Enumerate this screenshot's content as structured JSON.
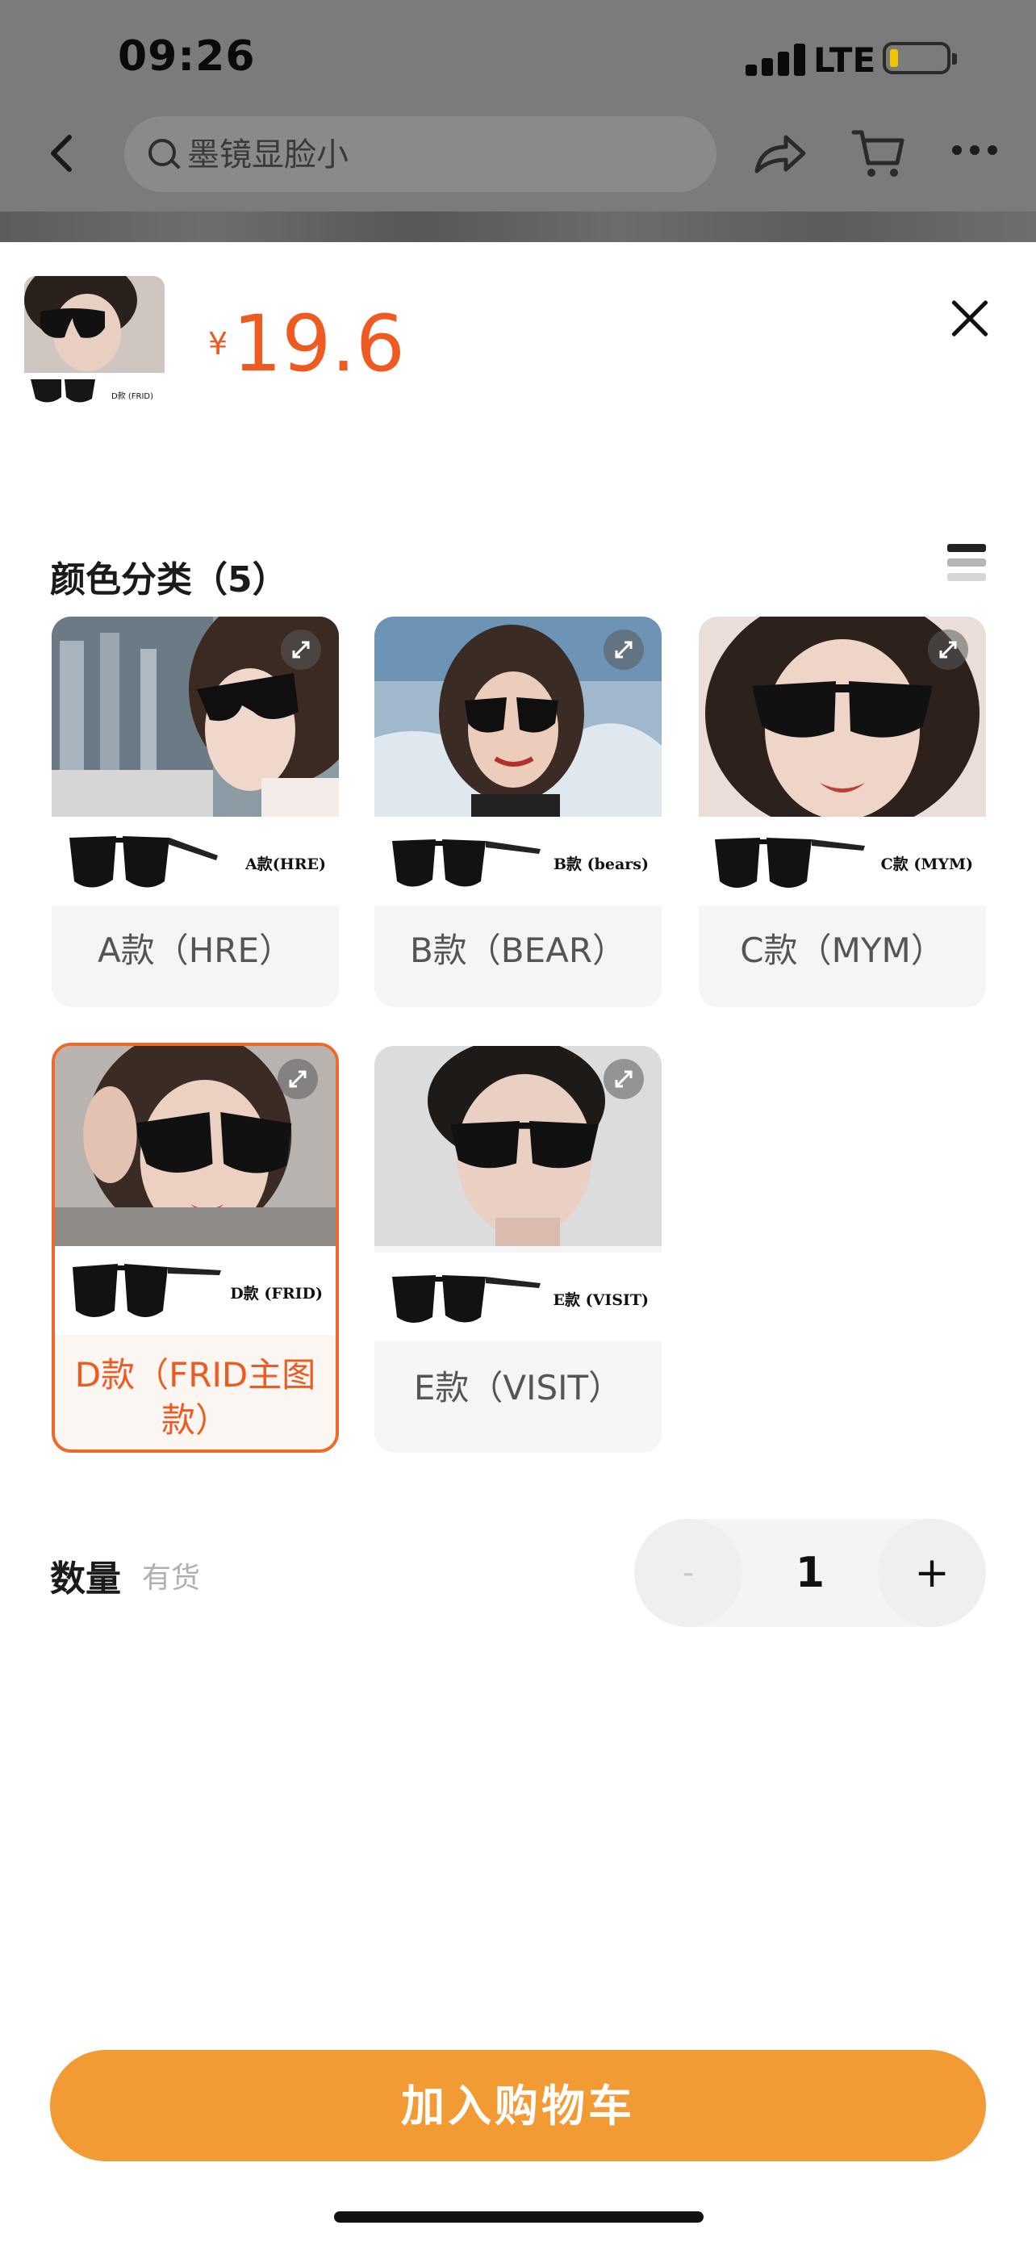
{
  "status_bar": {
    "time": "09:26",
    "network": "LTE",
    "battery_color": "#f2c500"
  },
  "nav": {
    "search_placeholder": "墨镜显脸小",
    "icons": [
      "back-chevron-icon",
      "search-icon",
      "share-icon",
      "cart-icon",
      "more-icon"
    ]
  },
  "product": {
    "currency": "¥",
    "price": "19.6",
    "thumb_tag": "D款 (FRID)"
  },
  "variants": {
    "title": "颜色分类（5）",
    "items": [
      {
        "label": "A款（HRE）",
        "tag": "A款(HRE)",
        "selected": false
      },
      {
        "label": "B款（BEAR）",
        "tag": "B款 (bears)",
        "selected": false
      },
      {
        "label": "C款（MYM）",
        "tag": "C款 (MYM)",
        "selected": false
      },
      {
        "label": "D款（FRID主图款）",
        "tag": "D款 (FRID)",
        "selected": true
      },
      {
        "label": "E款（VISIT）",
        "tag": "E款 (VISIT)",
        "selected": false
      }
    ]
  },
  "quantity": {
    "label": "数量",
    "stock": "有货",
    "minus": "-",
    "value": "1",
    "plus": "+"
  },
  "actions": {
    "add_to_cart": "加入购物车"
  },
  "colors": {
    "accent": "#ee5a1f",
    "button": "#f29a33"
  }
}
